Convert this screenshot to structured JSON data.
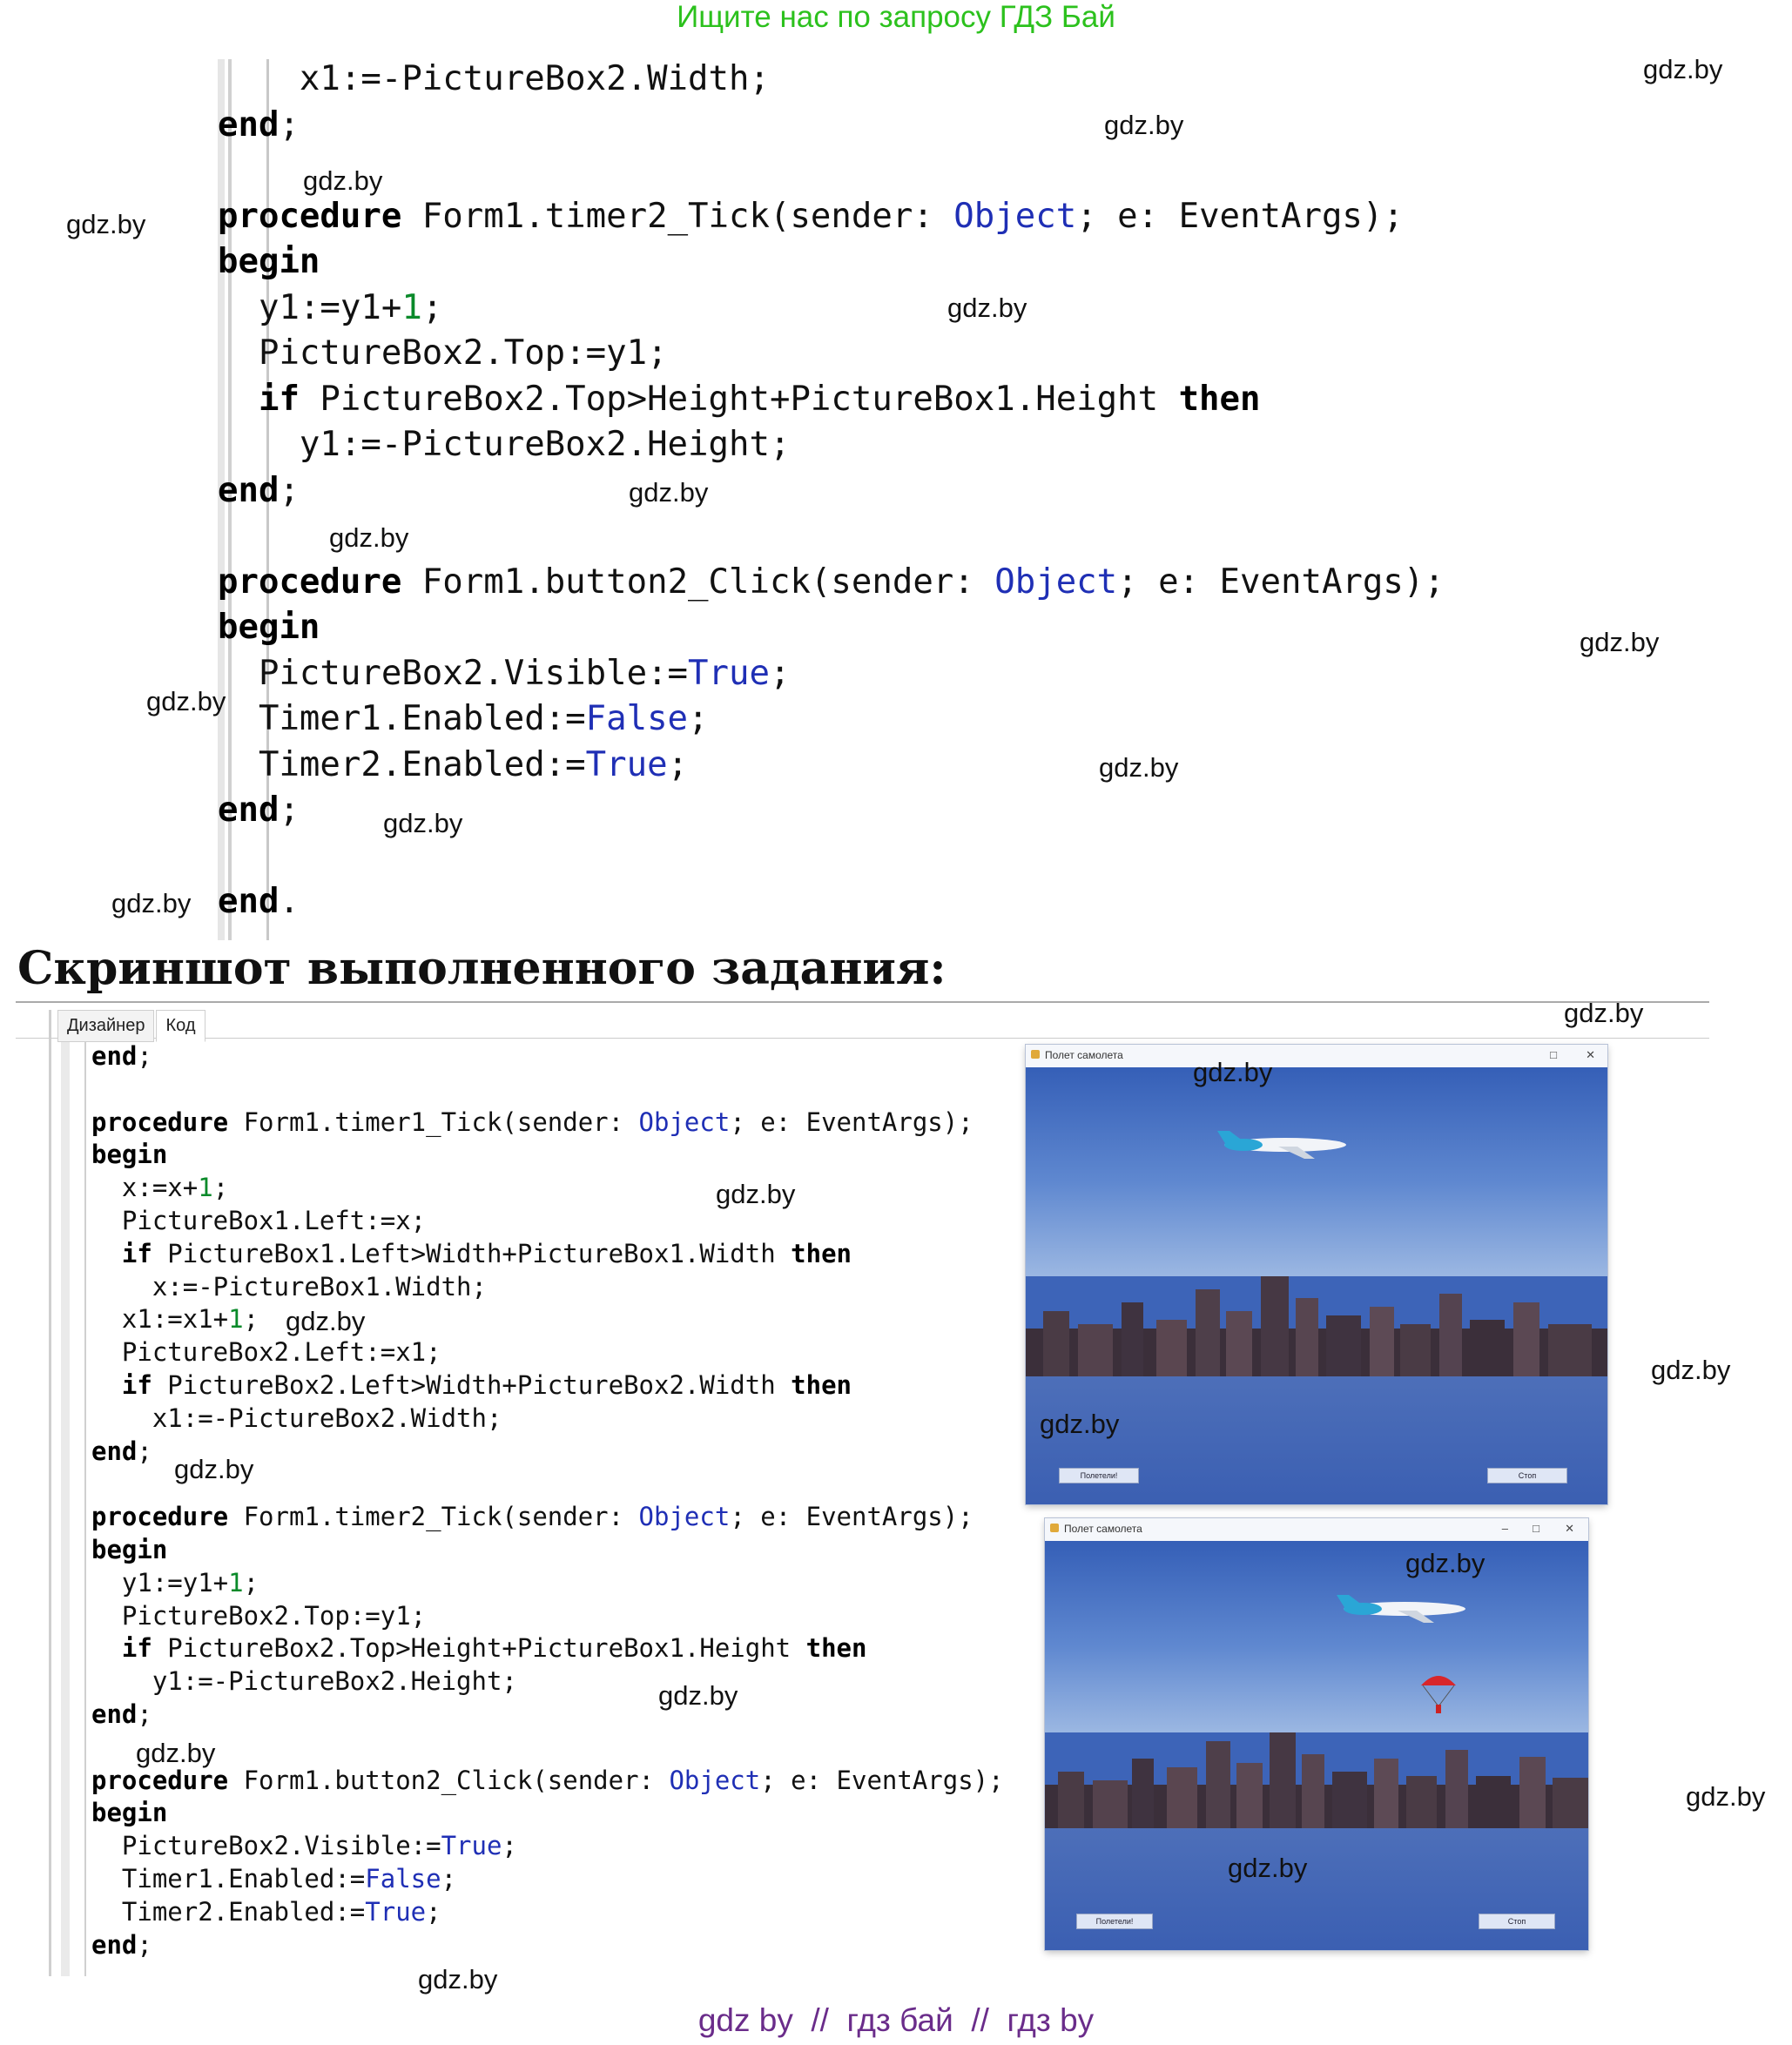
{
  "banner": "Ищите нас по запросу ГДЗ Бай",
  "heading": "Скриншот выполненного задания:",
  "ide": {
    "tabs": [
      "Дизайнер",
      "Код"
    ]
  },
  "code_top": [
    [
      {
        "t": "    x1:=-PictureBox2.Width;"
      }
    ],
    [
      {
        "t": "end",
        "c": "kw"
      },
      {
        "t": ";"
      }
    ],
    [],
    [
      {
        "t": "procedure",
        "c": "kw"
      },
      {
        "t": " Form1.timer2_Tick(sender: "
      },
      {
        "t": "Object",
        "c": "ty"
      },
      {
        "t": "; e: EventArgs);"
      }
    ],
    [
      {
        "t": "begin",
        "c": "kw"
      }
    ],
    [
      {
        "t": "  y1:=y1+"
      },
      {
        "t": "1",
        "c": "num"
      },
      {
        "t": ";"
      }
    ],
    [
      {
        "t": "  PictureBox2.Top:=y1;"
      }
    ],
    [
      {
        "t": "  "
      },
      {
        "t": "if",
        "c": "kw"
      },
      {
        "t": " PictureBox2.Top>Height+PictureBox1.Height "
      },
      {
        "t": "then",
        "c": "kw"
      }
    ],
    [
      {
        "t": "    y1:=-PictureBox2.Height;"
      }
    ],
    [
      {
        "t": "end",
        "c": "kw"
      },
      {
        "t": ";"
      }
    ],
    [],
    [
      {
        "t": "procedure",
        "c": "kw"
      },
      {
        "t": " Form1.button2_Click(sender: "
      },
      {
        "t": "Object",
        "c": "ty"
      },
      {
        "t": "; e: EventArgs);"
      }
    ],
    [
      {
        "t": "begin",
        "c": "kw"
      }
    ],
    [
      {
        "t": "  PictureBox2.Visible:="
      },
      {
        "t": "True",
        "c": "ty"
      },
      {
        "t": ";"
      }
    ],
    [
      {
        "t": "  Timer1.Enabled:="
      },
      {
        "t": "False",
        "c": "ty"
      },
      {
        "t": ";"
      }
    ],
    [
      {
        "t": "  Timer2.Enabled:="
      },
      {
        "t": "True",
        "c": "ty"
      },
      {
        "t": ";"
      }
    ],
    [
      {
        "t": "end",
        "c": "kw"
      },
      {
        "t": ";"
      }
    ],
    [],
    [
      {
        "t": "end",
        "c": "kw"
      },
      {
        "t": "."
      }
    ]
  ],
  "code_bottom": [
    [
      {
        "t": "end",
        "c": "kw"
      },
      {
        "t": ";"
      }
    ],
    [],
    [
      {
        "t": "procedure",
        "c": "kw"
      },
      {
        "t": " Form1.timer1_Tick(sender: "
      },
      {
        "t": "Object",
        "c": "ty"
      },
      {
        "t": "; e: EventArgs);"
      }
    ],
    [
      {
        "t": "begin",
        "c": "kw"
      }
    ],
    [
      {
        "t": "  x:=x+"
      },
      {
        "t": "1",
        "c": "num"
      },
      {
        "t": ";"
      }
    ],
    [
      {
        "t": "  PictureBox1.Left:=x;"
      }
    ],
    [
      {
        "t": "  "
      },
      {
        "t": "if",
        "c": "kw"
      },
      {
        "t": " PictureBox1.Left>Width+PictureBox1.Width "
      },
      {
        "t": "then",
        "c": "kw"
      }
    ],
    [
      {
        "t": "    x:=-PictureBox1.Width;"
      }
    ],
    [
      {
        "t": "  x1:=x1+"
      },
      {
        "t": "1",
        "c": "num"
      },
      {
        "t": ";"
      }
    ],
    [
      {
        "t": "  PictureBox2.Left:=x1;"
      }
    ],
    [
      {
        "t": "  "
      },
      {
        "t": "if",
        "c": "kw"
      },
      {
        "t": " PictureBox2.Left>Width+PictureBox2.Width "
      },
      {
        "t": "then",
        "c": "kw"
      }
    ],
    [
      {
        "t": "    x1:=-PictureBox2.Width;"
      }
    ],
    [
      {
        "t": "end",
        "c": "kw"
      },
      {
        "t": ";"
      }
    ],
    [],
    [
      {
        "t": "procedure",
        "c": "kw"
      },
      {
        "t": " Form1.timer2_Tick(sender: "
      },
      {
        "t": "Object",
        "c": "ty"
      },
      {
        "t": "; e: EventArgs);"
      }
    ],
    [
      {
        "t": "begin",
        "c": "kw"
      }
    ],
    [
      {
        "t": "  y1:=y1+"
      },
      {
        "t": "1",
        "c": "num"
      },
      {
        "t": ";"
      }
    ],
    [
      {
        "t": "  PictureBox2.Top:=y1;"
      }
    ],
    [
      {
        "t": "  "
      },
      {
        "t": "if",
        "c": "kw"
      },
      {
        "t": " PictureBox2.Top>Height+PictureBox1.Height "
      },
      {
        "t": "then",
        "c": "kw"
      }
    ],
    [
      {
        "t": "    y1:=-PictureBox2.Height;"
      }
    ],
    [
      {
        "t": "end",
        "c": "kw"
      },
      {
        "t": ";"
      }
    ],
    [],
    [
      {
        "t": "procedure",
        "c": "kw"
      },
      {
        "t": " Form1.button2_Click(sender: "
      },
      {
        "t": "Object",
        "c": "ty"
      },
      {
        "t": "; e: EventArgs);"
      }
    ],
    [
      {
        "t": "begin",
        "c": "kw"
      }
    ],
    [
      {
        "t": "  PictureBox2.Visible:="
      },
      {
        "t": "True",
        "c": "ty"
      },
      {
        "t": ";"
      }
    ],
    [
      {
        "t": "  Timer1.Enabled:="
      },
      {
        "t": "False",
        "c": "ty"
      },
      {
        "t": ";"
      }
    ],
    [
      {
        "t": "  Timer2.Enabled:="
      },
      {
        "t": "True",
        "c": "ty"
      },
      {
        "t": ";"
      }
    ],
    [
      {
        "t": "end",
        "c": "kw"
      },
      {
        "t": ";"
      }
    ]
  ],
  "windows": [
    {
      "title": "Полет самолета",
      "button_start": "Полетели!",
      "button_stop": "Стоп",
      "controls": [
        "□",
        "✕"
      ]
    },
    {
      "title": "Полет самолета",
      "button_start": "Полетели!",
      "button_stop": "Стоп",
      "controls": [
        "–",
        "□",
        "✕"
      ]
    }
  ],
  "watermark": "gdz.by",
  "footer": "gdz by  //  гдз бай  //  гдз by",
  "colors": {
    "banner": "#2cc11d",
    "keyword": "#000000",
    "type": "#1f2fb5",
    "number": "#0a8a2a",
    "footer": "#6a2c8a"
  }
}
